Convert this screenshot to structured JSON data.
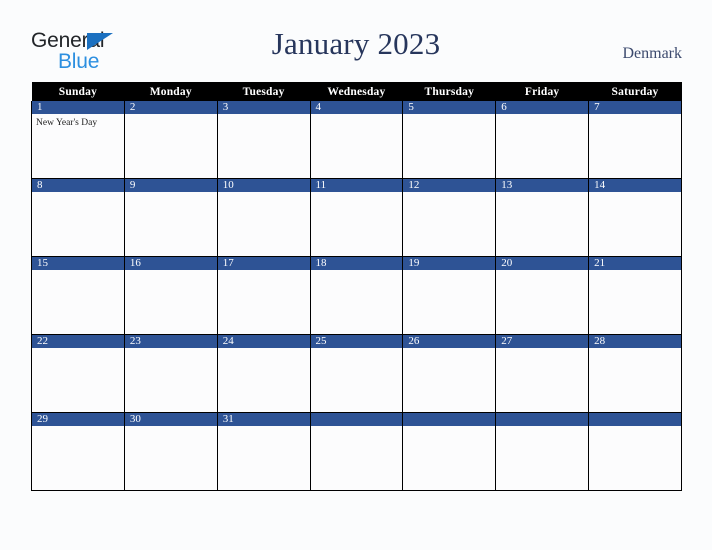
{
  "brand": {
    "name_part1": "General",
    "name_part2": "Blue",
    "triangle_color": "#1b70c0",
    "text_color_part1": "#222529",
    "text_color_part2": "#2d8fe0"
  },
  "header": {
    "title": "January 2023",
    "country": "Denmark",
    "title_color": "#27365c"
  },
  "calendar": {
    "month": "January",
    "year": "2023",
    "weekday_headers": [
      "Sunday",
      "Monday",
      "Tuesday",
      "Wednesday",
      "Thursday",
      "Friday",
      "Saturday"
    ],
    "header_bg": "#000000",
    "header_text_color": "#ffffff",
    "date_bar_color": "#2e5395",
    "date_text_color": "#ffffff",
    "cell_bg": "#fcfcfd",
    "grid_line_color": "#000000",
    "weeks": [
      [
        {
          "date": "1",
          "event": "New Year's Day"
        },
        {
          "date": "2",
          "event": ""
        },
        {
          "date": "3",
          "event": ""
        },
        {
          "date": "4",
          "event": ""
        },
        {
          "date": "5",
          "event": ""
        },
        {
          "date": "6",
          "event": ""
        },
        {
          "date": "7",
          "event": ""
        }
      ],
      [
        {
          "date": "8",
          "event": ""
        },
        {
          "date": "9",
          "event": ""
        },
        {
          "date": "10",
          "event": ""
        },
        {
          "date": "11",
          "event": ""
        },
        {
          "date": "12",
          "event": ""
        },
        {
          "date": "13",
          "event": ""
        },
        {
          "date": "14",
          "event": ""
        }
      ],
      [
        {
          "date": "15",
          "event": ""
        },
        {
          "date": "16",
          "event": ""
        },
        {
          "date": "17",
          "event": ""
        },
        {
          "date": "18",
          "event": ""
        },
        {
          "date": "19",
          "event": ""
        },
        {
          "date": "20",
          "event": ""
        },
        {
          "date": "21",
          "event": ""
        }
      ],
      [
        {
          "date": "22",
          "event": ""
        },
        {
          "date": "23",
          "event": ""
        },
        {
          "date": "24",
          "event": ""
        },
        {
          "date": "25",
          "event": ""
        },
        {
          "date": "26",
          "event": ""
        },
        {
          "date": "27",
          "event": ""
        },
        {
          "date": "28",
          "event": ""
        }
      ],
      [
        {
          "date": "29",
          "event": ""
        },
        {
          "date": "30",
          "event": ""
        },
        {
          "date": "31",
          "event": ""
        },
        {
          "date": "",
          "event": ""
        },
        {
          "date": "",
          "event": ""
        },
        {
          "date": "",
          "event": ""
        },
        {
          "date": "",
          "event": ""
        }
      ]
    ]
  }
}
